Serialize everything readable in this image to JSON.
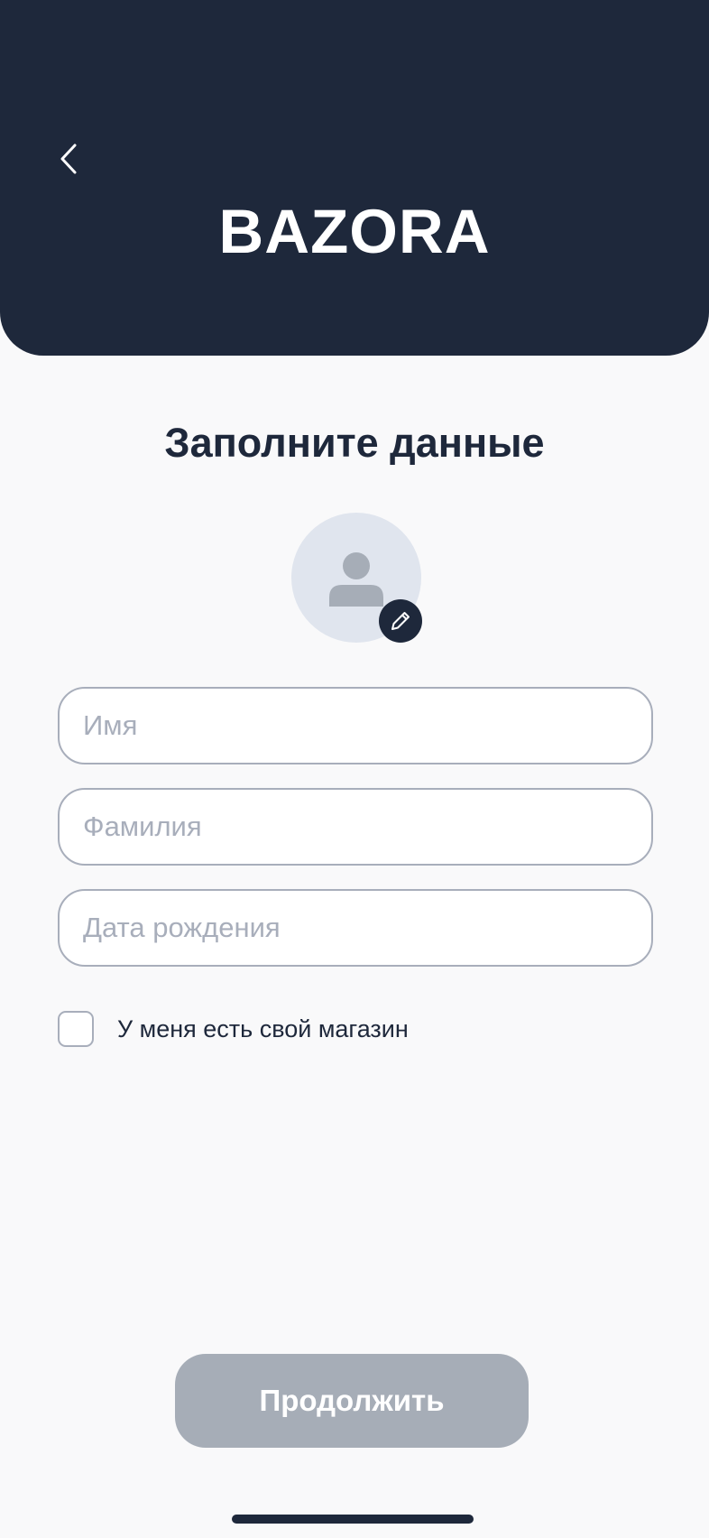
{
  "header": {
    "brand": "BAZORA",
    "back_icon": "chevron-left-icon",
    "background_color": "#1e283b"
  },
  "form": {
    "title": "Заполните данные",
    "avatar": {
      "icon": "user-icon",
      "edit_icon": "pencil-icon"
    },
    "fields": [
      {
        "placeholder": "Имя",
        "value": ""
      },
      {
        "placeholder": "Фамилия",
        "value": ""
      },
      {
        "placeholder": "Дата рождения",
        "value": ""
      }
    ],
    "checkbox": {
      "label": "У меня есть свой магазин",
      "checked": false
    },
    "continue_label": "Продолжить",
    "continue_disabled_color": "#a6adb7"
  }
}
